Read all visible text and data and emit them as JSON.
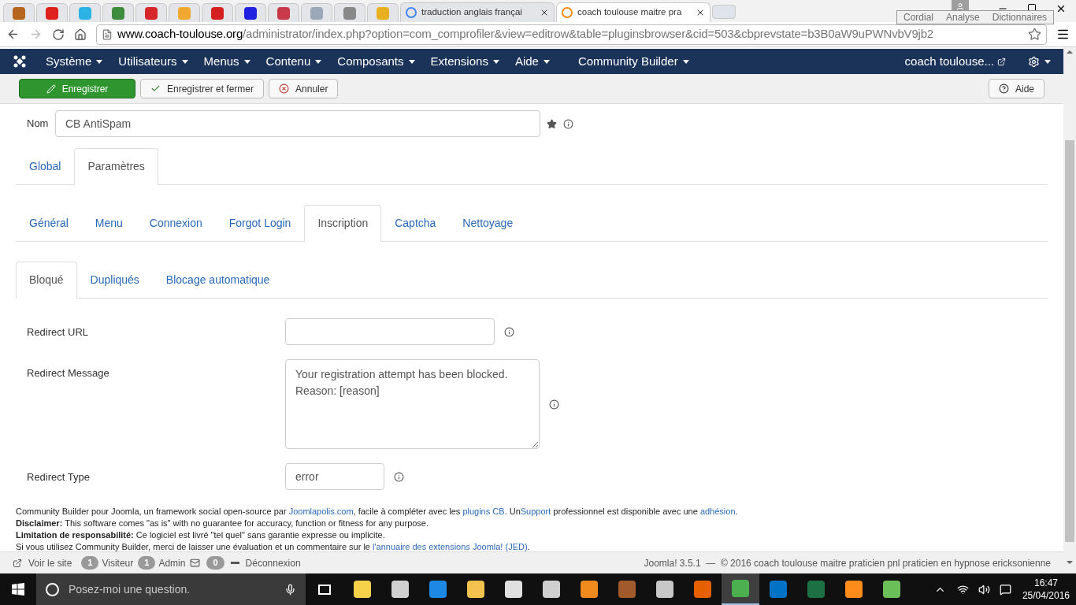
{
  "browser": {
    "pinned_tabs": [
      {
        "color": "#b5651d",
        "selected": false
      },
      {
        "color": "#e0201c",
        "selected": false
      },
      {
        "color": "#2bb3e6",
        "selected": false
      },
      {
        "color": "#3d8b3d",
        "selected": false
      },
      {
        "color": "#d6262a",
        "selected": false
      },
      {
        "color": "#f0a830",
        "selected": false
      },
      {
        "color": "#d42020",
        "selected": false
      },
      {
        "color": "#2020e0",
        "selected": false
      },
      {
        "color": "#c83a4a",
        "selected": false
      },
      {
        "color": "#9aa8b8",
        "selected": false
      },
      {
        "color": "#888888",
        "selected": false
      },
      {
        "color": "#e8b020",
        "selected": false
      }
    ],
    "tabs": [
      {
        "title": "traduction anglais françai",
        "selected": false
      },
      {
        "title": "coach toulouse maitre pra",
        "selected": true
      }
    ],
    "url_host": "www.coach-toulouse.org",
    "url_path": "/administrator/index.php?option=com_comprofiler&view=editrow&table=pluginsbrowser&cid=503&cbprevstate=b3B0aW9uPWNvbV9jb2",
    "popup": [
      "Cordial",
      "Analyse",
      "Dictionnaires"
    ]
  },
  "nav": {
    "items": [
      "Système",
      "Utilisateurs",
      "Menus",
      "Contenu",
      "Composants",
      "Extensions",
      "Aide",
      "Community Builder"
    ],
    "user": "coach toulouse..."
  },
  "toolbar": [
    {
      "label": "Enregistrer",
      "kind": "primary"
    },
    {
      "label": "Enregistrer et fermer",
      "kind": "check"
    },
    {
      "label": "Annuler",
      "kind": "cancel"
    }
  ],
  "help_button": "Aide",
  "name_field": {
    "label": "Nom",
    "value": "CB AntiSpam"
  },
  "tabs1": [
    {
      "label": "Global",
      "selected": false
    },
    {
      "label": "Paramètres",
      "selected": true
    }
  ],
  "tabs2": [
    {
      "label": "Général",
      "selected": false
    },
    {
      "label": "Menu",
      "selected": false
    },
    {
      "label": "Connexion",
      "selected": false
    },
    {
      "label": "Forgot Login",
      "selected": false
    },
    {
      "label": "Inscription",
      "selected": true
    },
    {
      "label": "Captcha",
      "selected": false
    },
    {
      "label": "Nettoyage",
      "selected": false
    }
  ],
  "tabs3": [
    {
      "label": "Bloqué",
      "selected": true
    },
    {
      "label": "Dupliqués",
      "selected": false
    },
    {
      "label": "Blocage automatique",
      "selected": false
    }
  ],
  "fields": [
    {
      "label": "Redirect URL",
      "kind": "url"
    },
    {
      "label": "Redirect Message",
      "kind": "textarea",
      "value": "Your registration attempt has been blocked.\nReason: [reason]"
    },
    {
      "label": "Redirect Type",
      "kind": "short",
      "value": "error"
    }
  ],
  "footer": [
    [
      {
        "text": "Community Builder pour Joomla, un framework social open-source par "
      },
      {
        "text": "Joomlapolis.com",
        "link": true
      },
      {
        "text": ", facile à compléter avec les "
      },
      {
        "text": "plugins CB",
        "link": true
      },
      {
        "text": ". Un"
      },
      {
        "text": "Support",
        "link": true
      },
      {
        "text": " professionnel est disponible avec une "
      },
      {
        "text": "adhésion",
        "link": true
      },
      {
        "text": "."
      }
    ],
    [
      {
        "text": "**Disclaimer:** This software comes \"as is\" with no guarantee for accuracy, function or fitness for any purpose."
      }
    ],
    [
      {
        "text": "**Limitation de responsabilité:** Ce logiciel est livré \"tel quel\" sans garantie expresse ou implicite."
      }
    ],
    [
      {
        "text": "Si vous utilisez Community Builder, merci de laisser une évaluation et un commentaire sur le "
      },
      {
        "text": "l'annuaire des extensions Joomla! (JED)",
        "link": true
      },
      {
        "text": "."
      }
    ]
  ],
  "status": {
    "view_site": "Voir le site",
    "visitors": "1",
    "visitors_label": "Visiteur",
    "admins": "1",
    "admins_label": "Admin",
    "messages": "0",
    "logout": "Déconnexion",
    "right": "Joomla! 3.5.1  —  © 2016 coach toulouse maitre praticien pnl praticien en hypnose ericksonienne"
  },
  "taskbar": {
    "search_placeholder": "Posez-moi une question.",
    "apps": [
      {
        "color": "#f5d24a",
        "selected": false
      },
      {
        "color": "#d0d0d0",
        "selected": false
      },
      {
        "color": "#1e88e5",
        "selected": false
      },
      {
        "color": "#f2c14e",
        "selected": false
      },
      {
        "color": "#e0e0e0",
        "selected": false
      },
      {
        "color": "#cfcfcf",
        "selected": false
      },
      {
        "color": "#f08a1c",
        "selected": false
      },
      {
        "color": "#a05a2c",
        "selected": false
      },
      {
        "color": "#c8c8c8",
        "selected": false
      },
      {
        "color": "#e66000",
        "selected": false
      },
      {
        "color": "#4caf50",
        "selected": true
      },
      {
        "color": "#0072c6",
        "selected": false
      },
      {
        "color": "#1d7044",
        "selected": false
      },
      {
        "color": "#ff8c1a",
        "selected": false
      },
      {
        "color": "#6bbf59",
        "selected": false
      }
    ],
    "time": "16:47",
    "date": "25/04/2016"
  }
}
